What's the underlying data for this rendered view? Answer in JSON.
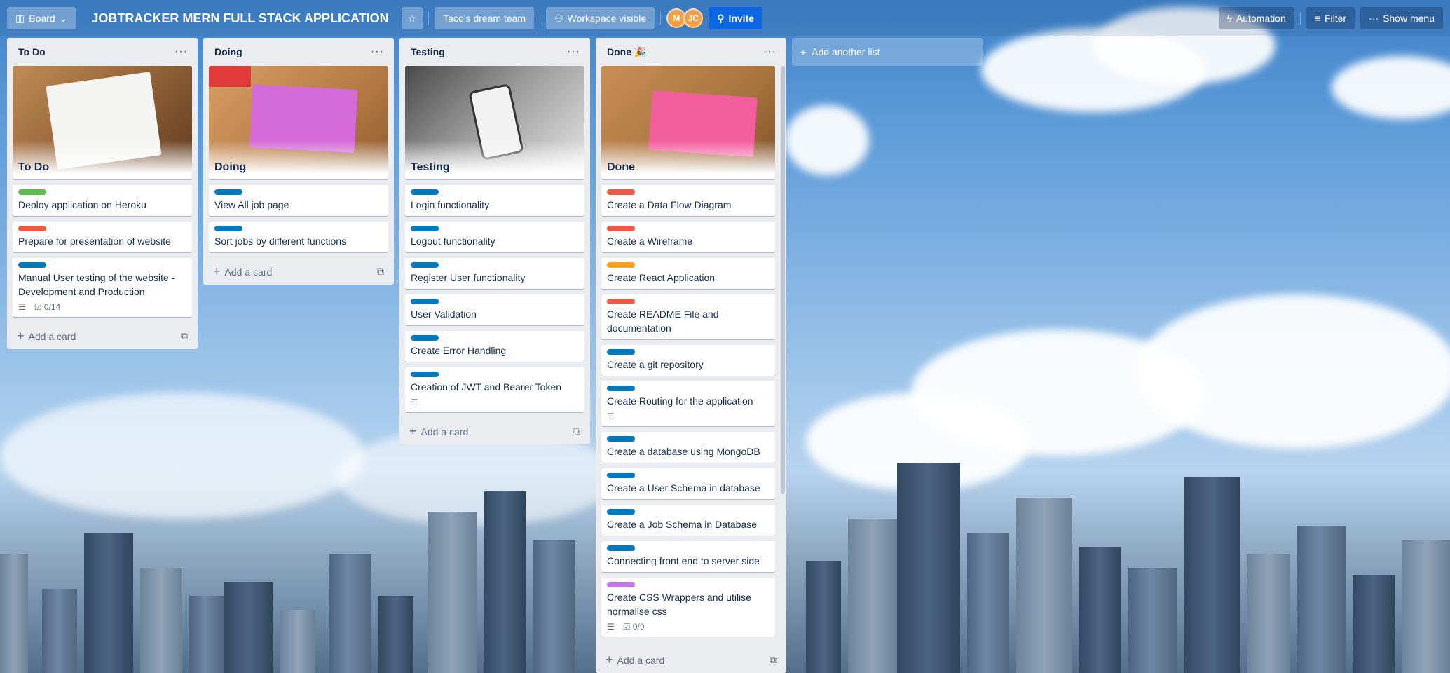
{
  "header": {
    "board_view": "Board",
    "board_title": "JOBTRACKER MERN FULL STACK APPLICATION",
    "workspace": "Taco's dream team",
    "visibility": "Workspace visible",
    "avatars": [
      "M",
      "JC"
    ],
    "invite": "Invite",
    "automation": "Automation",
    "filter": "Filter",
    "show_menu": "Show menu"
  },
  "lists": [
    {
      "title": "To Do",
      "cover_label": "To Do",
      "cards": [
        {
          "text": "Deploy application on Heroku",
          "label_color": "#61bd4f"
        },
        {
          "text": "Prepare for presentation of website",
          "label_color": "#eb5a46"
        },
        {
          "text": "Manual User testing of the website - Development and Production",
          "label_color": "#0079bf",
          "checklist": "0/14"
        }
      ],
      "add_card": "Add a card"
    },
    {
      "title": "Doing",
      "cover_label": "Doing",
      "cards": [
        {
          "text": "View All job page",
          "label_color": "#0079bf"
        },
        {
          "text": "Sort jobs by different functions",
          "label_color": "#0079bf"
        }
      ],
      "add_card": "Add a card"
    },
    {
      "title": "Testing",
      "cover_label": "Testing",
      "cards": [
        {
          "text": "Login functionality",
          "label_color": "#0079bf"
        },
        {
          "text": "Logout functionality",
          "label_color": "#0079bf"
        },
        {
          "text": "Register User functionality",
          "label_color": "#0079bf"
        },
        {
          "text": "User Validation",
          "label_color": "#0079bf"
        },
        {
          "text": "Create Error Handling",
          "label_color": "#0079bf"
        },
        {
          "text": "Creation of JWT and Bearer Token",
          "label_color": "#0079bf"
        }
      ],
      "add_card": "Add a card"
    },
    {
      "title": "Done 🎉",
      "cover_label": "Done",
      "cards": [
        {
          "text": "Create a Data Flow Diagram",
          "label_color": "#eb5a46"
        },
        {
          "text": "Create a Wireframe",
          "label_color": "#eb5a46"
        },
        {
          "text": "Create React Application",
          "label_color": "#ff9f1a"
        },
        {
          "text": "Create README File and documentation",
          "label_color": "#eb5a46"
        },
        {
          "text": "Create a git repository",
          "label_color": "#0079bf"
        },
        {
          "text": "Create Routing for the application",
          "label_color": "#0079bf"
        },
        {
          "text": "Create a database using MongoDB",
          "label_color": "#0079bf"
        },
        {
          "text": "Create a User Schema in database",
          "label_color": "#0079bf"
        },
        {
          "text": "Create a Job Schema in Database",
          "label_color": "#0079bf"
        },
        {
          "text": "Connecting front end to server side",
          "label_color": "#0079bf"
        },
        {
          "text": "Create CSS Wrappers and utilise normalise css",
          "label_color": "#c377e0",
          "checklist": "0/9"
        }
      ],
      "add_card": "Add a card"
    }
  ],
  "add_list": "Add another list",
  "colors": {
    "invite_bg": "#0c66e4",
    "list_bg": "#ebecf0",
    "avatar_bg": "#f2a045"
  }
}
